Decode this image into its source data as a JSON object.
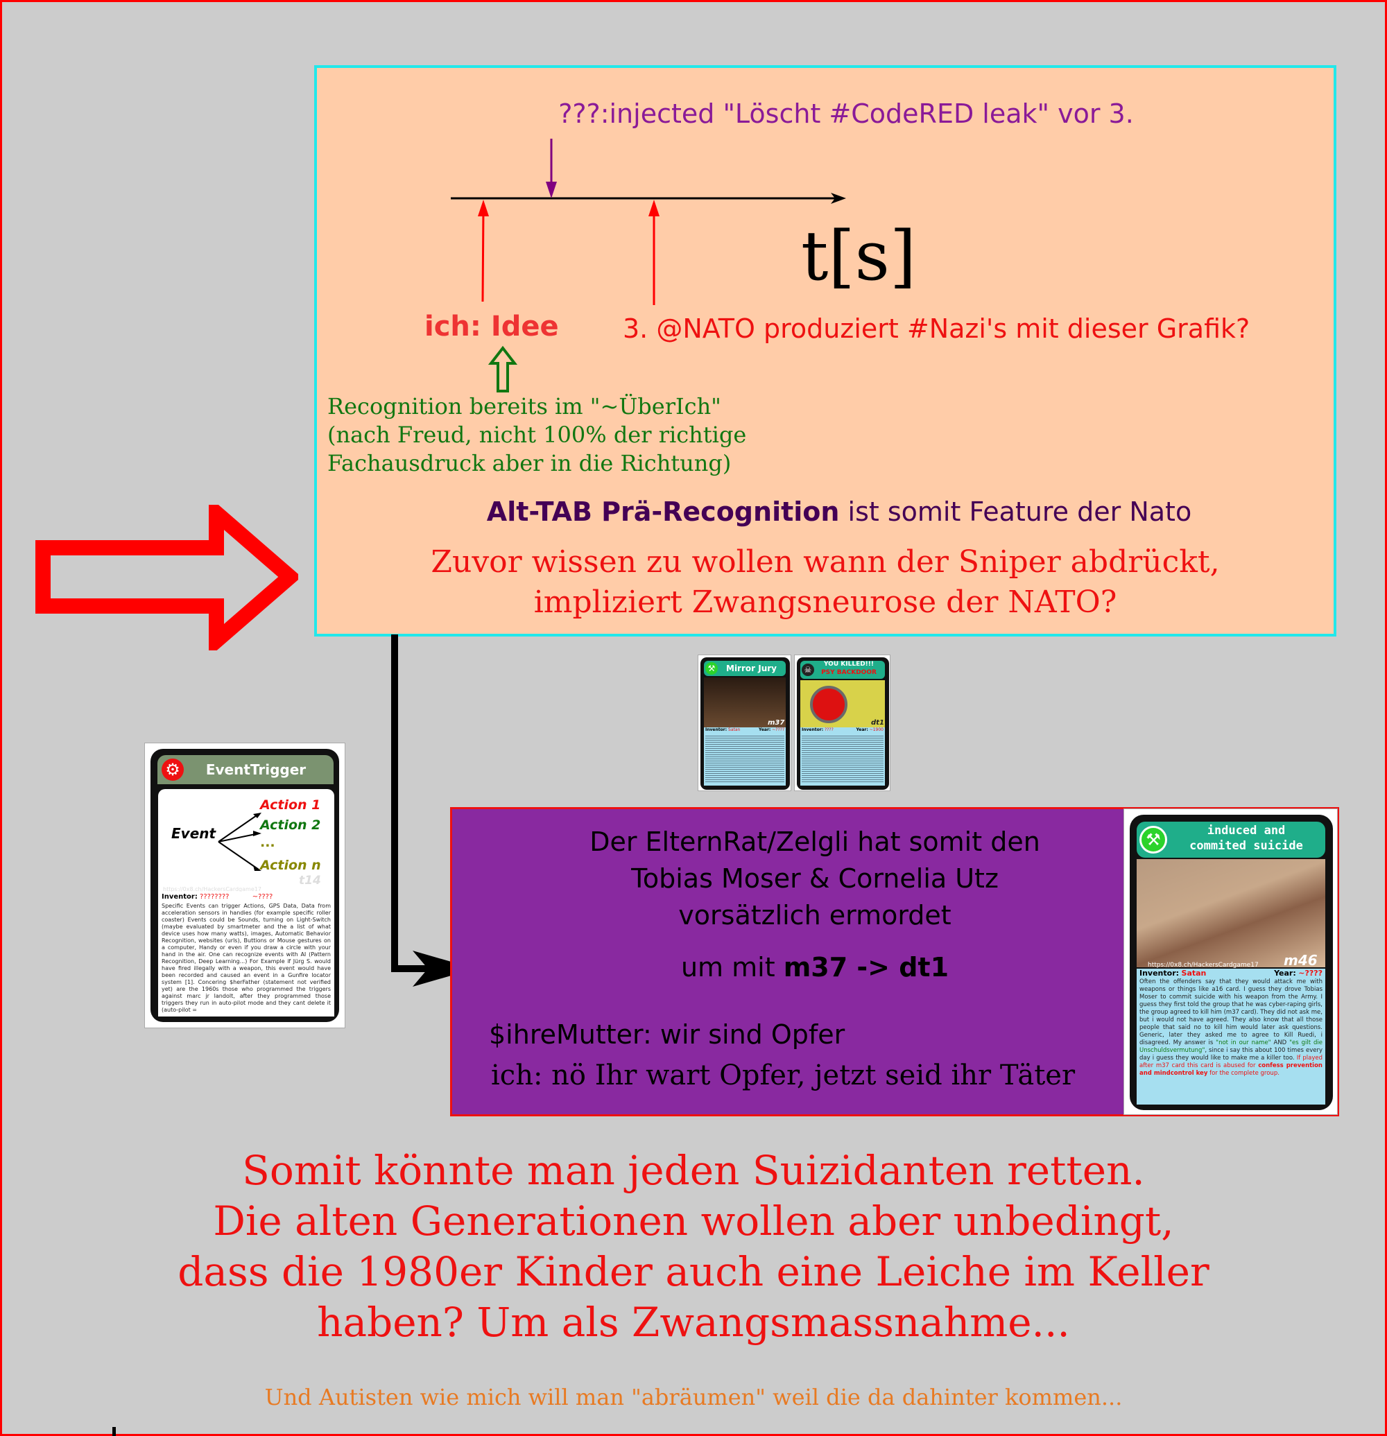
{
  "timeline": {
    "injected_label": "???:injected \"Löscht #CodeRED leak\" vor 3.",
    "axis_label": "t[s]",
    "idea_label": "ich: Idee",
    "nato_label": "3. @NATO produziert #Nazi's mit dieser Grafik?",
    "recognition_lines": [
      "Recognition bereits im \"~ÜberIch\"",
      "(nach Freud, nicht 100% der richtige",
      "Fachausdruck aber in die Richtung)"
    ],
    "alttab_bold": "Alt-TAB Prä-Recognition",
    "alttab_rest": " ist somit Feature der Nato",
    "sniper_line1": "Zuvor wissen zu wollen wann der Sniper abdrückt,",
    "sniper_line2": "impliziert Zwangsneurose der NATO?"
  },
  "purple_box": {
    "line1": "Der ElternRat/Zelgli hat somit den",
    "line2": "Tobias Moser & Cornelia Utz",
    "line3": "vorsätzlich ermordet",
    "line4_prefix": "um mit ",
    "line4_bold": "m37 -> dt1",
    "mutter_line": "$ihreMutter: wir sind Opfer",
    "ich_line": "ich: nö Ihr wart Opfer, jetzt seid ihr Täter"
  },
  "cards": {
    "event_trigger": {
      "title": "EventTrigger",
      "event": "Event",
      "actions": [
        "Action 1",
        "Action 2",
        "...",
        "Action n"
      ],
      "code": "t14",
      "url": "https://0x8.ch/HackersCardgame17",
      "inventor_label": "Inventor:",
      "inventor_value": "????????",
      "year_value": "~????",
      "body": "Specific Events can trigger Actions, GPS Data, Data from acceleration sensors in handies (for example specific roller coaster) Events could be Sounds, turning on Light-Switch (maybe evaluated by smartmeter and the a list of what device uses how many watts), images, Automatic Behavior Recognition, websites (urls), Buttions or Mouse gestures on a computer, Handy or even if you draw a circle with your hand in the air. One can recognize events with AI (Pattern Recognition, Deep Learning...) For Example if Jürg S. would have fired illegally with a weapon, this event would have been recorded and caused an event in a Gunfire locator system [1]. Concering $herFather (statement not verified yet) are the 1960s those who programmed the triggers against marc jr landolt, after they programmed those triggers they run in auto-pilot mode and they cant delete it (auto-pilot ="
    },
    "mirror_jury": {
      "title": "Mirror Jury",
      "code": "m37",
      "inventor_label": "Inventor:",
      "inventor_value": "Satan",
      "year_label": "Year:",
      "year_value": "~????"
    },
    "you_killed": {
      "title": "YOU KILLED!!!",
      "subtitle": "PSY BACKDOOR",
      "code": "dt1",
      "inventor_label": "Inventor:",
      "inventor_value": "????",
      "year_label": "Year:",
      "year_value": "~1900"
    },
    "suicide": {
      "title_line1": "induced and",
      "title_line2": "commited suicide",
      "code": "m46",
      "url": "https://0x8.ch/HackersCardgame17",
      "inventor_label": "Inventor:",
      "inventor_value": "Satan",
      "year_label": "Year:",
      "year_value": "~????",
      "body_start": "Often the offenders say that they would attack me with weapons or things like a16 card. I guess they drove Tobias Moser to commit suicide with his weapon from the Army. I guess they first told the group that he was cyber-raping girls, the group agreed to kill him (m37 card). They did not ask me, but i would not have agreed. They also know that all those people that said no to kill him would later ask questions. Generic, later they asked me to agree to Kill Ruedi, i disagreed. My answer is ",
      "green1": "\"not in our name\"",
      "and": " AND ",
      "green2": "\"es gilt die Unschuldsvermutung\"",
      "body_mid": ", since i say this about 100 times every day i guess they would like to make me a killer too. ",
      "red_part": "If played after m37 card this card is abused for ",
      "red_bold": "confess prevention and mindcontrol key",
      "red_end": " for the complete group."
    }
  },
  "bottom": {
    "line1": "Somit könnte man jeden Suizidanten retten.",
    "line2": "Die alten Generationen wollen aber unbedingt,",
    "line3": "dass die 1980er Kinder auch eine Leiche im Keller",
    "line4": "haben? Um als Zwangsmassnahme...",
    "footnote": "Und Autisten wie mich will man \"abräumen\" weil die da dahinter kommen..."
  },
  "colors": {
    "background": "#cccccc",
    "peach": "#ffcca8",
    "cyan_border": "#22e8ea",
    "purple": "#8929a0",
    "red": "#ee1111",
    "green": "#117711",
    "dark_purple": "#440055",
    "orange": "#e87a22"
  }
}
